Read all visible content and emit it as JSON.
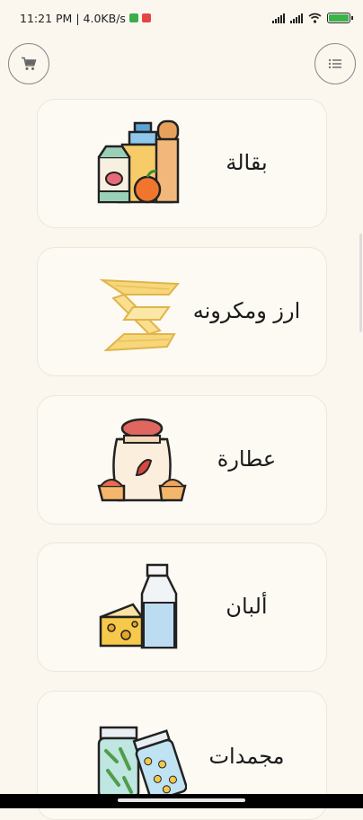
{
  "status": {
    "time": "11:21 PM",
    "network_speed": "4.0KB/s",
    "separator": "|",
    "battery_level": 1.0
  },
  "header": {
    "cart_icon": "cart-icon",
    "menu_icon": "menu-lines-icon"
  },
  "categories": [
    {
      "label": "بقالة",
      "icon": "grocery-bag-icon"
    },
    {
      "label": "ارز ومكرونه",
      "icon": "pasta-icon"
    },
    {
      "label": "عطارة",
      "icon": "spices-sack-icon"
    },
    {
      "label": "ألبان",
      "icon": "milk-cheese-icon"
    },
    {
      "label": "مجمدات",
      "icon": "frozen-jars-icon"
    }
  ],
  "colors": {
    "background": "#fbf7ef",
    "card_border": "#ece6db",
    "text": "#1a1a1a"
  }
}
